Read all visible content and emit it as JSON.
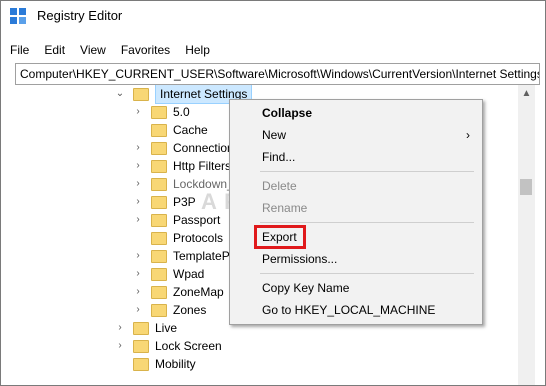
{
  "window": {
    "title": "Registry Editor",
    "app_icon": "registry-editor-icon"
  },
  "menu": [
    "File",
    "Edit",
    "View",
    "Favorites",
    "Help"
  ],
  "address": "Computer\\HKEY_CURRENT_USER\\Software\\Microsoft\\Windows\\CurrentVersion\\Internet Settings",
  "tree": {
    "selected": "Internet Settings",
    "children": [
      "5.0",
      "Cache",
      "Connection",
      "Http Filters",
      "Lockdown_Z",
      "P3P",
      "Passport",
      "Protocols",
      "TemplatePo",
      "Wpad",
      "ZoneMap",
      "Zones"
    ],
    "siblings": [
      "Live",
      "Lock Screen",
      "Mobility"
    ]
  },
  "context_menu": {
    "collapse": "Collapse",
    "new": "New",
    "new_arrow": "›",
    "find": "Find...",
    "delete": "Delete",
    "rename": "Rename",
    "export": "Export",
    "permissions": "Permissions...",
    "copy_key_name": "Copy Key Name",
    "goto": "Go to HKEY_LOCAL_MACHINE"
  },
  "watermark": "A PUALS",
  "colors": {
    "highlight": "#e0191b",
    "selection": "#cce8ff",
    "folder": "#f8d775"
  }
}
